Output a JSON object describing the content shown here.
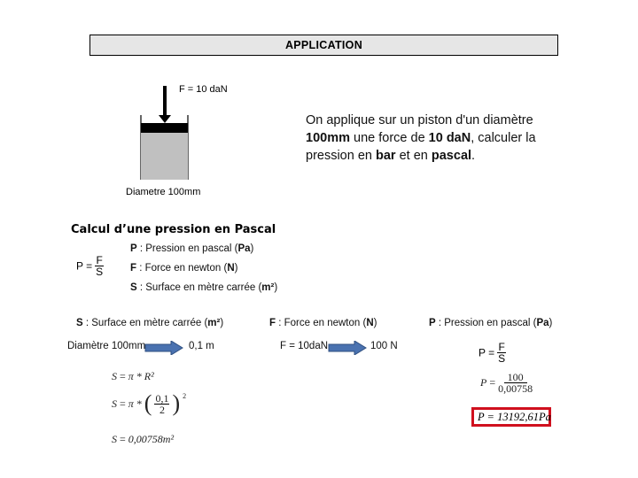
{
  "title": "APPLICATION",
  "diagram": {
    "force_label": "F = 10 daN",
    "diameter_label": "Diametre 100mm",
    "colors": {
      "piston": "#000000",
      "fluid": "#c0c0c0"
    }
  },
  "problem": {
    "t1": "On applique sur un piston d'un diamètre ",
    "b1": "100mm",
    "t2": " une force de ",
    "b2": "10 daN",
    "t3": ", calculer la pression en ",
    "b3": "bar",
    "t4": " et en ",
    "b4": "pascal",
    "t5": "."
  },
  "section": {
    "heading": "Calcul d’une pression en Pascal",
    "formula": {
      "lhs": "P =",
      "num": "F",
      "den": "S"
    },
    "definitions": [
      {
        "sym": "P",
        "text": " : Pression en pascal (",
        "unit": "Pa",
        "close": ")"
      },
      {
        "sym": "F",
        "text": " : Force en newton (",
        "unit": "N",
        "close": ")"
      },
      {
        "sym": "S",
        "text": " : Surface en mètre carrée (",
        "unit": "m²",
        "close": ")"
      }
    ]
  },
  "columns": {
    "surface": {
      "header": {
        "sym": "S",
        "text": " : Surface en mètre carrée (",
        "unit": "m²",
        "close": ")"
      },
      "from": "Diamètre 100mm",
      "to": "0,1 m",
      "eq1": {
        "lhs": "S",
        "op": "=",
        "rhs": "π * R²"
      },
      "eq2": {
        "lhs": "S",
        "op": "=",
        "pre": "π *",
        "num": "0,1",
        "den": "2",
        "exp": "2"
      },
      "eq3": {
        "lhs": "S",
        "op": "=",
        "rhs": "0,00758m²"
      }
    },
    "force": {
      "header": {
        "sym": "F",
        "text": " : Force en newton (",
        "unit": "N",
        "close": ")"
      },
      "from": "F = 10daN",
      "to": "100 N"
    },
    "pressure": {
      "header": {
        "sym": "P",
        "text": " : Pression en pascal (",
        "unit": "Pa",
        "close": ")"
      },
      "formula": {
        "lhs": "P =",
        "num": "F",
        "den": "S"
      },
      "eq1": {
        "lhs": "P",
        "op": "=",
        "num": "100",
        "den": "0,00758"
      },
      "result": "P = 13192,61Pa",
      "result_border_color": "#d0101e"
    }
  },
  "arrow_color": "#4a72b0"
}
